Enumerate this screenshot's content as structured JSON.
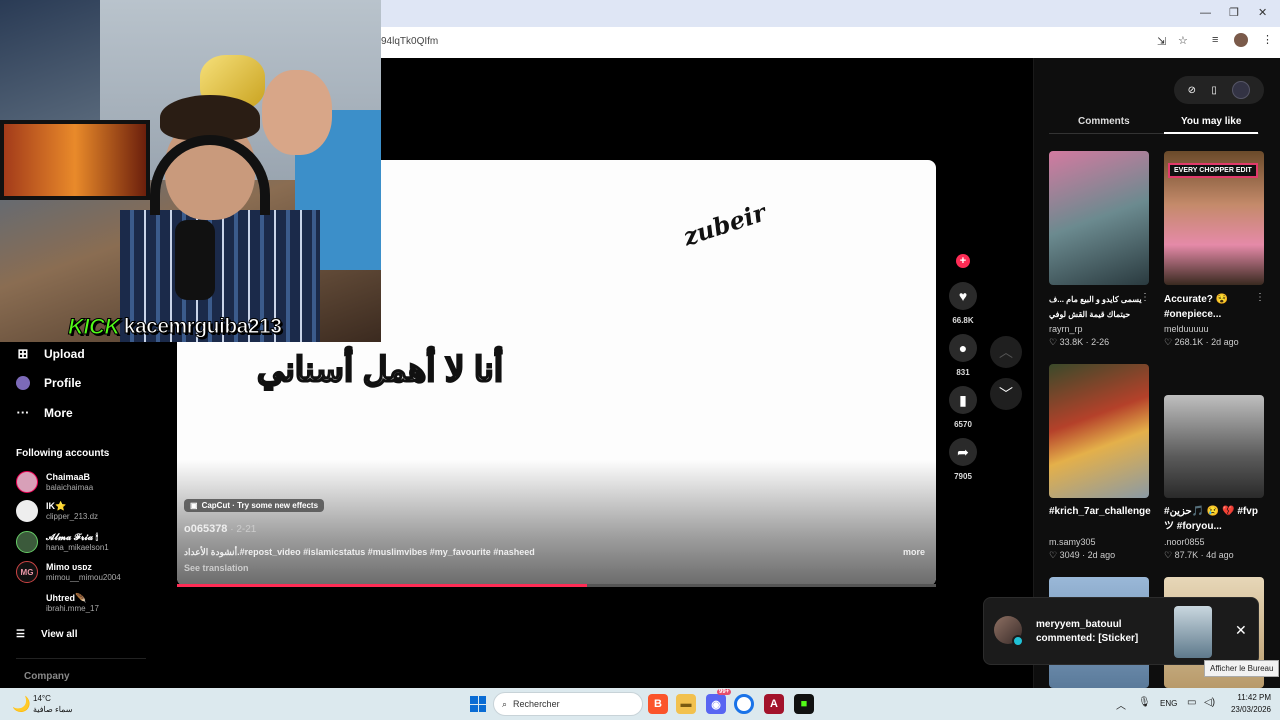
{
  "browser": {
    "url_fragment": "94lqTk0QIfm"
  },
  "overlay": {
    "kick_logo": "KICK",
    "kick_user": "kacemrguiba213"
  },
  "sidebar": {
    "items": [
      {
        "label": "Upload",
        "icon": "upload-icon"
      },
      {
        "label": "Profile",
        "icon": "profile-icon"
      },
      {
        "label": "More",
        "icon": "more-dots-icon"
      }
    ],
    "following_title": "Following accounts",
    "accounts": [
      {
        "name": "ChaimaaB",
        "handle": "balaichaimaa",
        "initials": ""
      },
      {
        "name": "IK⭐",
        "handle": "clipper_213.dz",
        "initials": ""
      },
      {
        "name": "𝓐𝓵𝓶𝓪 𝓕𝓻𝓲𝓪 🕯",
        "handle": "hana_mikaelson1",
        "initials": ""
      },
      {
        "name": "Mimo ᴜsᴅz",
        "handle": "mimou__mimou2004",
        "initials": "MG"
      },
      {
        "name": "Uhtred🪶",
        "handle": "ibrahi.mme_17",
        "initials": ""
      }
    ],
    "view_all": "View all",
    "company": "Company"
  },
  "video": {
    "watermark": "zubeir",
    "arabic_text": "أنا لا أهمل أسناني",
    "capcut_label": "CapCut · Try some new effects",
    "author": "o065378",
    "date": " · 2-21",
    "caption": "أنشودة الأعداد.#repost_video #islamicstatus #muslimvibes #my_favourite #nasheed",
    "more": "more",
    "translate": "See translation",
    "progress": 0.54
  },
  "actions": {
    "likes": "66.8K",
    "comments": "831",
    "saves": "6570",
    "shares": "7905"
  },
  "right_panel": {
    "tabs": [
      "Comments",
      "You may like"
    ],
    "active_tab": "You may like",
    "cards": [
      {
        "title": "يسمى كايدو و البيع مام ...ف حيتماك قيمة القش لوفي",
        "user": "rayrn_rp",
        "likes": "33.8K",
        "date": "2-26",
        "badge": ""
      },
      {
        "title": "Accurate? 😵 #onepiece...",
        "user": "melduuuuu",
        "likes": "268.1K",
        "date": "2d ago",
        "badge": "EVERY CHOPPER EDIT"
      },
      {
        "title": "#krich_7ar_challenge",
        "user": "m.samy305",
        "likes": "3049",
        "date": "2d ago",
        "badge": ""
      },
      {
        "title": "#حزين🎵 😢 💔 #fvp ツ #foryou...",
        "user": ".noor0855",
        "likes": "87.7K",
        "date": "4d ago",
        "badge": ""
      }
    ]
  },
  "notification": {
    "user": "meryyem_batouul",
    "text": "commented: [Sticker]"
  },
  "tooltip": "Afficher le Bureau",
  "taskbar": {
    "temp": "14°C",
    "weather": "سماء صافية",
    "search": "Rechercher",
    "lang": "ENG",
    "time": "11:42 PM",
    "date": "23/03/2026",
    "discord_badge": "99+"
  },
  "colors": {
    "accent": "#fe2c55",
    "kick_green": "#53fc18",
    "taskbar": "#dce9ee"
  }
}
